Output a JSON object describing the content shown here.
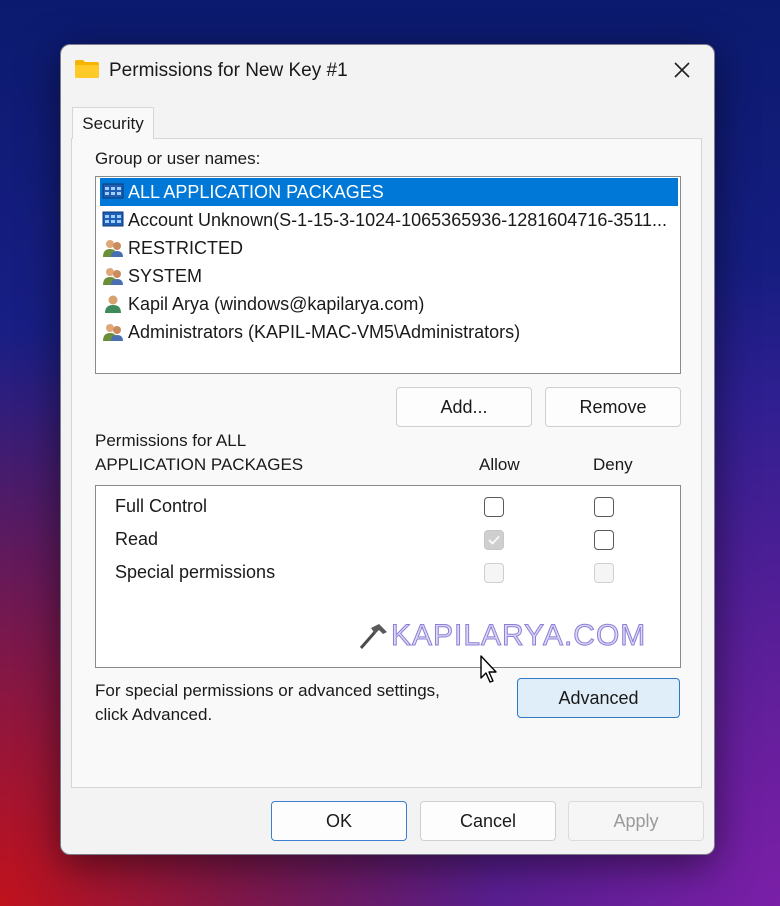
{
  "window": {
    "title": "Permissions for New Key #1",
    "tab_label": "Security"
  },
  "group_list": {
    "label": "Group or user names:",
    "items": [
      {
        "name": "ALL APPLICATION PACKAGES",
        "icon": "app-packages-icon",
        "selected": true
      },
      {
        "name": "Account Unknown(S-1-15-3-1024-1065365936-1281604716-3511...",
        "icon": "app-packages-icon",
        "selected": false
      },
      {
        "name": "RESTRICTED",
        "icon": "group-users-icon",
        "selected": false
      },
      {
        "name": "SYSTEM",
        "icon": "group-users-icon",
        "selected": false
      },
      {
        "name": "Kapil Arya (windows@kapilarya.com)",
        "icon": "single-user-icon",
        "selected": false
      },
      {
        "name": "Administrators (KAPIL-MAC-VM5\\Administrators)",
        "icon": "group-users-icon",
        "selected": false
      }
    ]
  },
  "buttons": {
    "add": "Add...",
    "remove": "Remove",
    "advanced": "Advanced",
    "ok": "OK",
    "cancel": "Cancel",
    "apply": "Apply"
  },
  "permissions": {
    "label_line1": "Permissions for ALL",
    "label_line2": "APPLICATION PACKAGES",
    "allow_header": "Allow",
    "deny_header": "Deny",
    "rows": [
      {
        "name": "Full Control",
        "allow": "unchecked",
        "deny": "unchecked"
      },
      {
        "name": "Read",
        "allow": "checked-disabled",
        "deny": "unchecked"
      },
      {
        "name": "Special permissions",
        "allow": "disabled",
        "deny": "disabled"
      }
    ]
  },
  "advanced_hint": {
    "line1": "For special permissions or advanced settings,",
    "line2": "click Advanced."
  },
  "watermark": "KAPILARYA.COM",
  "colors": {
    "selection": "#0078d7",
    "focus_border": "#3a7fd0",
    "watermark": "#8d7fd8"
  }
}
